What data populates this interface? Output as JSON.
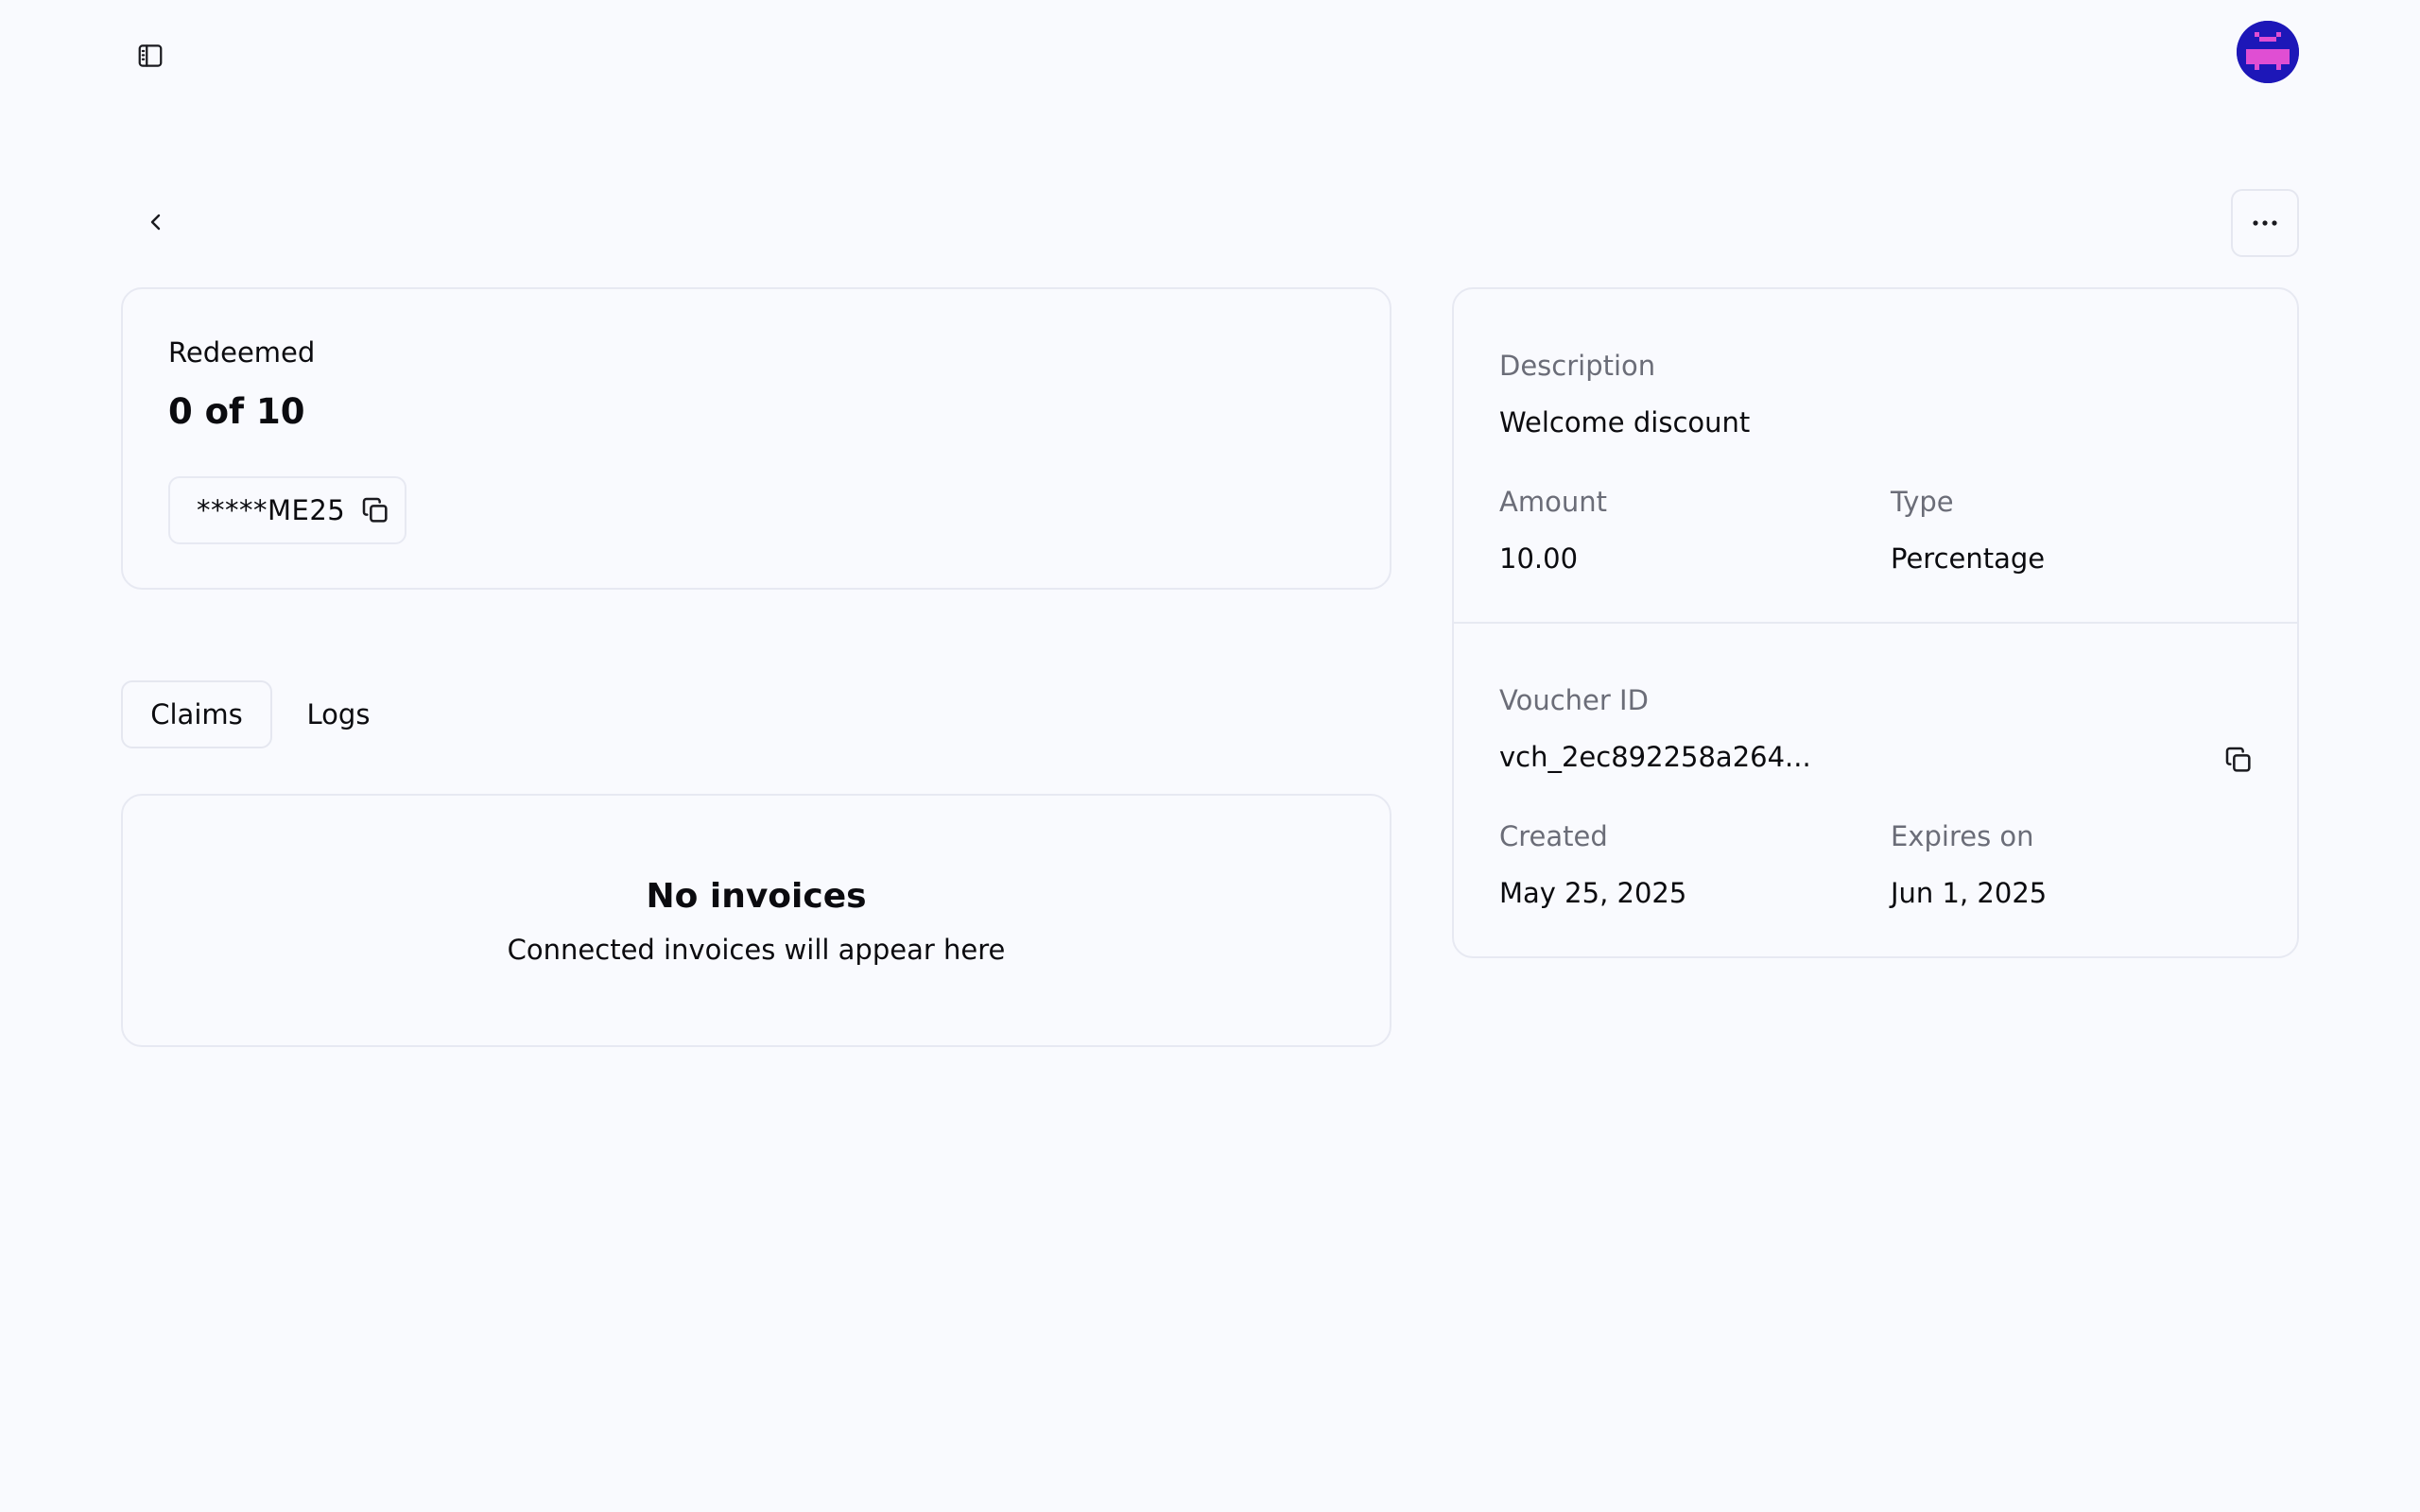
{
  "header": {
    "sidebar_toggle_icon": "sidebar-panel-icon",
    "avatar_colors": {
      "background": "#1d17b8",
      "face": "#e04ed3"
    }
  },
  "toolbar": {
    "back_icon": "chevron-left-icon",
    "more_icon": "ellipsis-icon"
  },
  "redeemed": {
    "label": "Redeemed",
    "value": "0 of 10",
    "code": "*****ME25",
    "copy_icon": "copy-icon"
  },
  "tabs": [
    {
      "label": "Claims",
      "active": true
    },
    {
      "label": "Logs",
      "active": false
    }
  ],
  "empty_state": {
    "title": "No invoices",
    "subtitle": "Connected invoices will appear here"
  },
  "details": {
    "description_label": "Description",
    "description_value": "Welcome discount",
    "amount_label": "Amount",
    "amount_value": "10.00",
    "type_label": "Type",
    "type_value": "Percentage",
    "voucher_id_label": "Voucher ID",
    "voucher_id_value": "vch_2ec892258a264...",
    "created_label": "Created",
    "created_value": "May 25, 2025",
    "expires_label": "Expires on",
    "expires_value": "Jun 1, 2025"
  }
}
